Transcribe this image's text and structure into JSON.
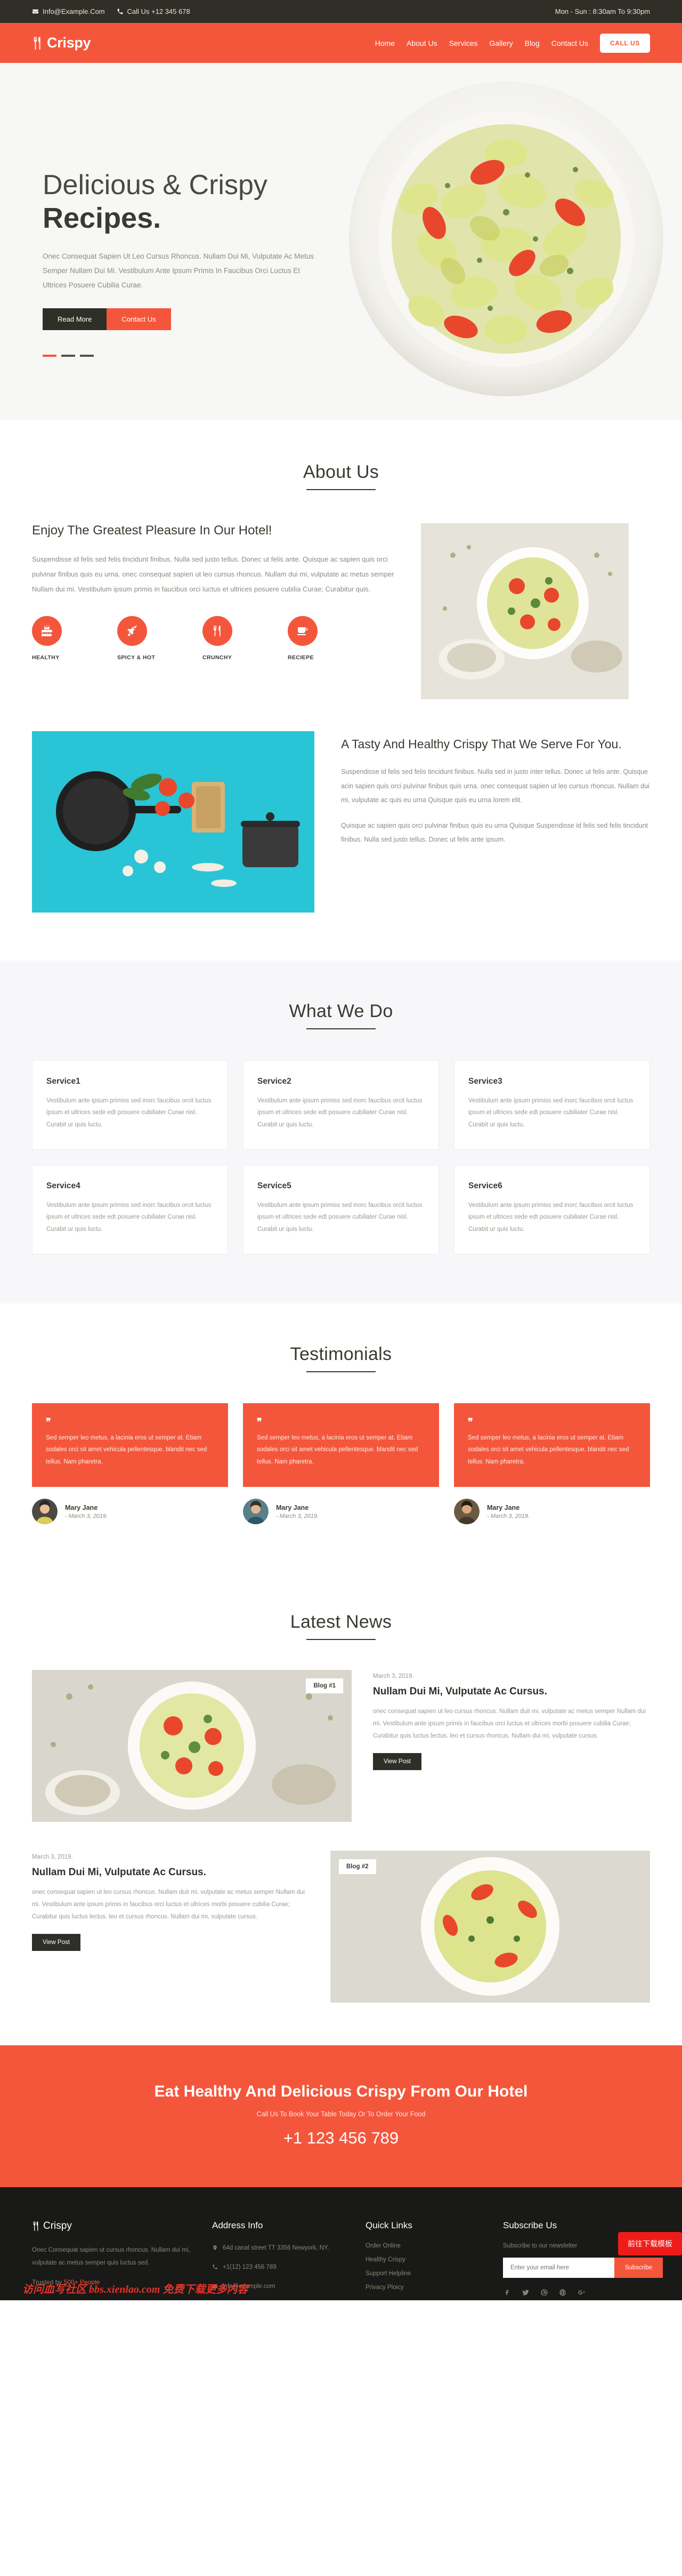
{
  "topbar": {
    "email": "Info@Example.Com",
    "phone": "Call Us +12 345 678",
    "hours": "Mon - Sun : 8:30am To 9:30pm",
    "email_icon": "envelope-icon",
    "phone_icon": "phone-icon"
  },
  "nav": {
    "brand": "Crispy",
    "brand_icon": "fork-knife-icon",
    "links": [
      {
        "label": "Home"
      },
      {
        "label": "About Us"
      },
      {
        "label": "Services"
      },
      {
        "label": "Gallery"
      },
      {
        "label": "Blog"
      },
      {
        "label": "Contact Us"
      }
    ],
    "cta": "CALL US"
  },
  "hero": {
    "line1": "Delicious & Crispy",
    "line2": "Recipes.",
    "paragraph": "Onec Consequat Sapien Ut Leo Cursus Rhoncus. Nullam Dui Mi, Vulputate Ac Metus Semper Nullam Dui Mi. Vestibulum Ante Ipsum Primis In Faucibus Orci Luctus Et Ultrices Posuere Cubilia Curae.",
    "btn_primary": "Read More",
    "btn_secondary": "Contact Us"
  },
  "about": {
    "title": "About Us",
    "heading": "Enjoy The Greatest Pleasure In Our Hotel!",
    "paragraph": "Suspendisse id felis sed felis tincidunt finibus. Nulla sed justo tellus. Donec ut felis ante. Quisque ac sapien quis orci pulvinar finibus quis eu urna. onec consequat sapien ut leo cursus rhoncus. Nullam dui mi, vulputate ac metus semper Nullam dui mi. Vestibulum ipsum primis in faucibus orci luctus et ultrices posuere cubilia Curae; Curabitur quis.",
    "features": [
      {
        "label": "HEALTHY",
        "icon": "cake-icon"
      },
      {
        "label": "SPICY & HOT",
        "icon": "rocket-icon"
      },
      {
        "label": "CRUNCHY",
        "icon": "fork-knife-icon"
      },
      {
        "label": "RECIEPE",
        "icon": "coffee-cup-icon"
      }
    ]
  },
  "about2": {
    "heading": "A Tasty And Healthy Crispy That We Serve For You.",
    "paragraph1": "Suspendisse id felis sed felis tincidunt finibus. Nulla sed in justo inter tellus. Donec ut felis ante. Quisque acin sapien quis orci pulvinar finibus quis urna. onec consequat sapien ut leo cursus rhoncus. Nullam dui mi, vulputate ac quis eu urna Quisque quis eu urna lorem elit.",
    "paragraph2": "Quisque ac sapien quis orci pulvinar finibus quis eu urna Quisque Suspendisse id felis sed felis tincidunt finibus. Nulla sed justo tellus. Donec ut felis ante ipsum."
  },
  "services": {
    "title": "What We Do",
    "body": "Vestibulum ante ipsum primiss sed inorc faucibus orcit luctus ipsum et ultrices sede edt posuere cubiliater Curae nisl. Curabit ur quis luctu.",
    "cards": [
      {
        "title": "Service1"
      },
      {
        "title": "Service2"
      },
      {
        "title": "Service3"
      },
      {
        "title": "Service4"
      },
      {
        "title": "Service5"
      },
      {
        "title": "Service6"
      }
    ]
  },
  "testimonials": {
    "title": "Testimonials",
    "items": [
      {
        "quote": "Sed semper leo metus, a lacinia eros ut semper at. Etiam sodales orci sit amet vehicula pellentesque. blandit nec sed tellus. Nam pharetra.",
        "name": "Mary Jane",
        "date": "- March 3, 2019."
      },
      {
        "quote": "Sed semper leo metus, a lacinia eros ut semper at. Etiam sodales orci sit amet vehicula pellentesque. blandit nec sed tellus. Nam pharetra.",
        "name": "Mary Jane",
        "date": "- March 3, 2019."
      },
      {
        "quote": "Sed semper leo metus, a lacinia eros ut semper at. Etiam sodales orci sit amet vehicula pellentesque. blandit nec sed tellus. Nam pharetra.",
        "name": "Mary Jane",
        "date": "- March 3, 2019."
      }
    ]
  },
  "news": {
    "title": "Latest News",
    "posts": [
      {
        "badge": "Blog #1",
        "date": "March 3, 2019.",
        "heading": "Nullam Dui Mi, Vulputate Ac Cursus.",
        "body": "onec consequat sapien ut leo cursus rhoncus. Nullam duit mi, vulputate ac metus semper Nullam dui mi. Vestibulum ante ipsum primis in faucibus orci luctus et ultrices morbi posuere cubilia Curae; Curabitur quis luctus lectus. leo et cursus rhoncus. Nullam dui mi, vulputate cursus.",
        "button": "View Post"
      },
      {
        "badge": "Blog #2",
        "date": "March 3, 2019.",
        "heading": "Nullam Dui Mi, Vulputate Ac Cursus.",
        "body": "onec consequat sapien ut leo cursus rhoncus. Nullam duit mi, vulputate ac metus semper Nullam dui mi. Vestibulum ante ipsum primis in faucibus orci luctus et ultrices morbi posuere cubilia Curae; Curabitur quis luctus lectus. leo et cursus rhoncus. Nullam dui mi, vulputate cursus.",
        "button": "View Post"
      }
    ]
  },
  "cta": {
    "heading": "Eat Healthy And Delicious Crispy From Our Hotel",
    "sub": "Call Us To Book Your Table Today Or To Order Your Food",
    "phone": "+1 123 456 789"
  },
  "footer": {
    "brand": "Crispy",
    "brand_icon": "fork-knife-icon",
    "about": "Onec Consequat sapien ut cursus rhoncus. Nullam dui mi, vulputate ac metus semper quis luctus sed.",
    "trust_prefix": "Trusted by ",
    "trust_highlight": "500+ People",
    "address_title": "Address Info",
    "address_line": "64d canal street TT 3356 Newyork, NY.",
    "address_phone": "+1(12) 123 456 789",
    "address_email": "info@example.com",
    "quick_title": "Quick Links",
    "quick_links": [
      {
        "label": "Order Online"
      },
      {
        "label": "Healthy Crispy"
      },
      {
        "label": "Support Helpline"
      },
      {
        "label": "Privacy Ploicy"
      }
    ],
    "subscribe_title": "Subscribe Us",
    "subscribe_text": "Subscribe to our newsletter",
    "subscribe_placeholder": "Enter your email here",
    "subscribe_button": "Subscribe",
    "socials": [
      {
        "icon": "facebook-icon"
      },
      {
        "icon": "twitter-icon"
      },
      {
        "icon": "dribbble-icon"
      },
      {
        "icon": "pinterest-icon"
      },
      {
        "icon": "google-plus-icon"
      }
    ]
  },
  "overlay": {
    "watermark": "访问血写社区 bbs.xienlao.com 免费下载更多内容",
    "download_button": "前往下载模板"
  },
  "colors": {
    "accent": "#f4563c",
    "dark": "#2f2f28",
    "footer_bg": "#191917"
  }
}
